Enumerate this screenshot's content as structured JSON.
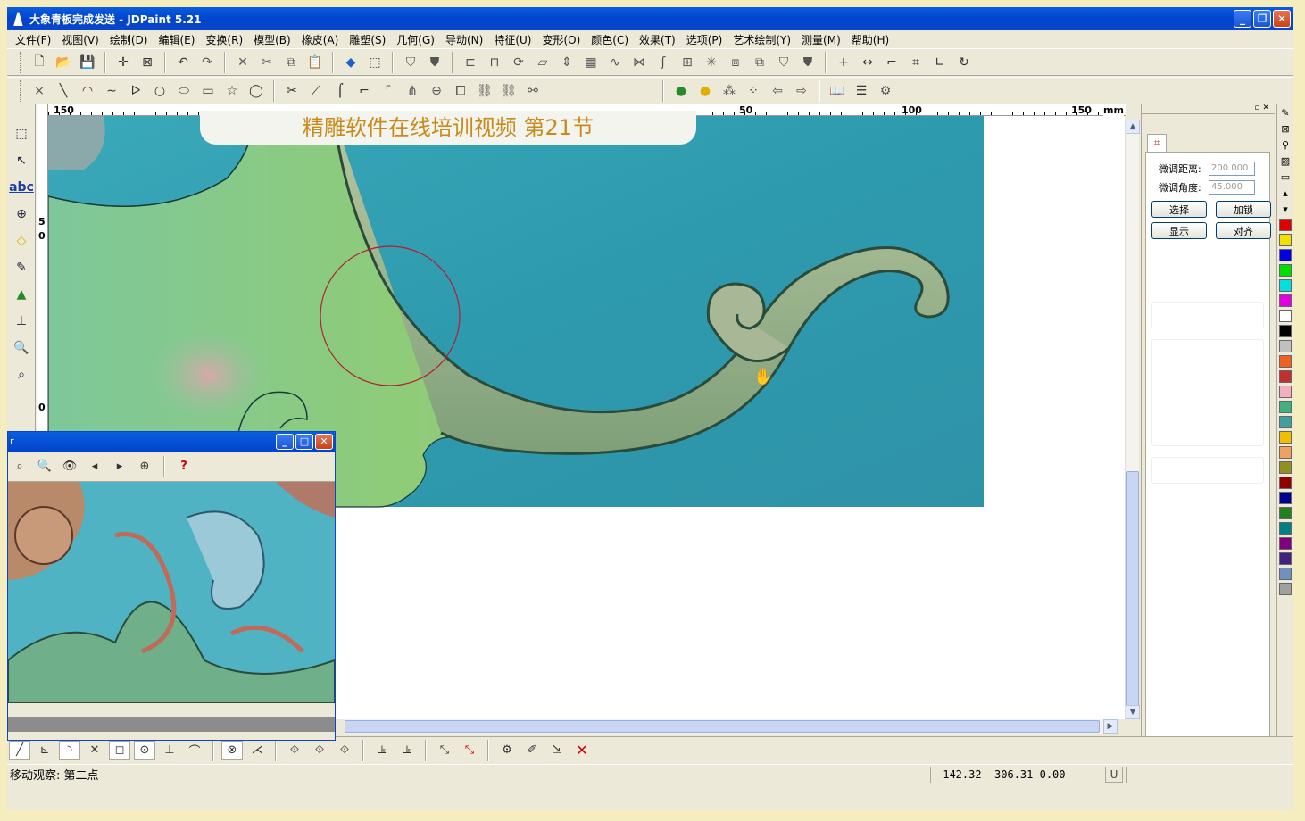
{
  "window": {
    "title": "大象青板完成发送 - JDPaint 5.21"
  },
  "menu": [
    "文件(F)",
    "视图(V)",
    "绘制(D)",
    "编辑(E)",
    "变换(R)",
    "模型(B)",
    "橡皮(A)",
    "雕塑(S)",
    "几何(G)",
    "导动(N)",
    "特征(U)",
    "变形(O)",
    "颜色(C)",
    "效果(T)",
    "选项(P)",
    "艺术绘制(Y)",
    "测量(M)",
    "帮助(H)"
  ],
  "banner": {
    "text": "精雕软件在线培训视频   第21节"
  },
  "ruler_top": {
    "labels": [
      "150",
      "50",
      "100",
      "150",
      "mm"
    ]
  },
  "ruler_left": {
    "labels": [
      "5",
      "0",
      "0"
    ]
  },
  "right_panel": {
    "distance_label": "微调距离:",
    "distance_value": "200.000",
    "angle_label": "微调角度:",
    "angle_value": "45.000",
    "buttons": [
      "选择",
      "加锁",
      "显示",
      "对齐"
    ]
  },
  "palette": [
    "#e00000",
    "#f0e000",
    "#0000e0",
    "#00e000",
    "#00e0e0",
    "#e000e0",
    "#ffffff",
    "#000000",
    "#c0c0c0",
    "#f06020",
    "#c03030",
    "#f0b0c0",
    "#40b080",
    "#40a0a0",
    "#f0c000",
    "#f0a060",
    "#909020",
    "#900000",
    "#000090",
    "#208020",
    "#008080",
    "#800080",
    "#402080",
    "#7090c0",
    "#a0a0a0"
  ],
  "preview": {
    "title": "r"
  },
  "status": {
    "message": "移动观察: 第二点",
    "coords": "-142.32  -306.31  0.00",
    "unit": "U"
  }
}
